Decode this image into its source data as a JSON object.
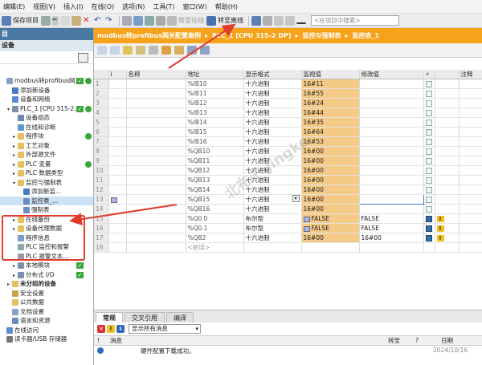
{
  "menu": [
    "编辑(E)",
    "视图(V)",
    "插入(I)",
    "在线(O)",
    "选项(N)",
    "工具(T)",
    "窗口(W)",
    "帮助(H)"
  ],
  "toolbar": {
    "save_label": "保存项目",
    "go_online": "转至在线",
    "go_offline": "转至离线",
    "search_placeholder": "<在项目中搜索>"
  },
  "left_panel": {
    "title": "目",
    "subtitle": "设备",
    "tree": [
      {
        "label": "modbus转profibus网...",
        "level": 0,
        "bold": false,
        "icon": "doc-icon",
        "status": "ok"
      },
      {
        "label": "添加新设备",
        "level": 1,
        "icon": "add-device-icon"
      },
      {
        "label": "设备和网络",
        "level": 1,
        "icon": "network-icon"
      },
      {
        "label": "PLC_1 [CPU 315-2...",
        "level": 1,
        "icon": "cpu-icon",
        "arrow": "▾",
        "status": "ok"
      },
      {
        "label": "设备组态",
        "level": 2,
        "icon": "config-icon"
      },
      {
        "label": "在线和诊断",
        "level": 2,
        "icon": "diagnose-icon"
      },
      {
        "label": "程序块",
        "level": 2,
        "icon": "folder-icon",
        "arrow": "▸",
        "status": "dot"
      },
      {
        "label": "工艺对象",
        "level": 2,
        "icon": "folder-icon",
        "arrow": "▸"
      },
      {
        "label": "外部源文件",
        "level": 2,
        "icon": "folder-icon",
        "arrow": "▸"
      },
      {
        "label": "PLC 变量",
        "level": 2,
        "icon": "folder-icon",
        "arrow": "▸",
        "status": "dot"
      },
      {
        "label": "PLC 数据类型",
        "level": 2,
        "icon": "folder-icon",
        "arrow": "▸"
      },
      {
        "label": "监控与强制表",
        "level": 2,
        "icon": "folder-icon",
        "arrow": "▾"
      },
      {
        "label": "添加新监...",
        "level": 3,
        "icon": "add-icon"
      },
      {
        "label": "监控表_...",
        "level": 3,
        "icon": "table-icon",
        "selected": true
      },
      {
        "label": "强制表",
        "level": 3,
        "icon": "table-icon"
      },
      {
        "label": "在线备份",
        "level": 2,
        "icon": "folder-icon",
        "arrow": "▸"
      },
      {
        "label": "设备代理数据",
        "level": 2,
        "icon": "folder-icon",
        "arrow": "▸"
      },
      {
        "label": "程序信息",
        "level": 2,
        "icon": "info-icon"
      },
      {
        "label": "PLC 监控和报警",
        "level": 2,
        "icon": "alarm-icon"
      },
      {
        "label": "PLC 报警文本...",
        "level": 2,
        "icon": "text-icon"
      },
      {
        "label": "本地模块",
        "level": 2,
        "icon": "module-icon",
        "arrow": "▸",
        "status": "chk"
      },
      {
        "label": "分布式 I/O",
        "level": 2,
        "icon": "io-icon",
        "arrow": "▸",
        "status": "chk"
      },
      {
        "label": "未分组的设备",
        "level": 1,
        "icon": "folder-icon",
        "arrow": "▸",
        "bold": true
      },
      {
        "label": "安全设置",
        "level": 1,
        "icon": "security-icon"
      },
      {
        "label": "公共数据",
        "level": 1,
        "icon": "folder-icon"
      },
      {
        "label": "文档设置",
        "level": 1,
        "icon": "doc-icon"
      },
      {
        "label": "语言和资源",
        "level": 1,
        "icon": "lang-icon"
      },
      {
        "label": "在线访问",
        "level": 0,
        "icon": "online-icon"
      },
      {
        "label": "读卡器/USB 存储器",
        "level": 0,
        "icon": "usb-icon"
      }
    ]
  },
  "header": {
    "crumbs": [
      "modbus转profibus网关配置案例",
      "PLC_1 [CPU 315-2 DP]",
      "监控与强制表",
      "监控表_1"
    ]
  },
  "table": {
    "columns": [
      "",
      "i",
      "名称",
      "地址",
      "显示格式",
      "监视值",
      "修改值",
      "⚡",
      "",
      "注释"
    ],
    "rows": [
      {
        "num": "1",
        "addr": "%IB10",
        "fmt": "十六进制",
        "mon": "16#11",
        "mod": "",
        "chk": false,
        "warn": false
      },
      {
        "num": "2",
        "addr": "%IB11",
        "fmt": "十六进制",
        "mon": "16#55",
        "mod": "",
        "chk": false,
        "warn": false
      },
      {
        "num": "3",
        "addr": "%IB12",
        "fmt": "十六进制",
        "mon": "16#24",
        "mod": "",
        "chk": false,
        "warn": false
      },
      {
        "num": "4",
        "addr": "%IB13",
        "fmt": "十六进制",
        "mon": "16#44",
        "mod": "",
        "chk": false,
        "warn": false
      },
      {
        "num": "5",
        "addr": "%IB14",
        "fmt": "十六进制",
        "mon": "16#35",
        "mod": "",
        "chk": false,
        "warn": false
      },
      {
        "num": "6",
        "addr": "%IB15",
        "fmt": "十六进制",
        "mon": "16#64",
        "mod": "",
        "chk": false,
        "warn": false
      },
      {
        "num": "7",
        "addr": "%IB16",
        "fmt": "十六进制",
        "mon": "16#53",
        "mod": "",
        "chk": false,
        "warn": false
      },
      {
        "num": "8",
        "addr": "%QB10",
        "fmt": "十六进制",
        "mon": "16#00",
        "mod": "",
        "chk": false,
        "warn": false
      },
      {
        "num": "9",
        "addr": "%QB11",
        "fmt": "十六进制",
        "mon": "16#00",
        "mod": "",
        "chk": false,
        "warn": false
      },
      {
        "num": "10",
        "addr": "%QB12",
        "fmt": "十六进制",
        "mon": "16#00",
        "mod": "",
        "chk": false,
        "warn": false
      },
      {
        "num": "11",
        "addr": "%QB13",
        "fmt": "十六进制",
        "mon": "16#00",
        "mod": "",
        "chk": false,
        "warn": false
      },
      {
        "num": "12",
        "addr": "%QB14",
        "fmt": "十六进制",
        "mon": "16#00",
        "mod": "",
        "chk": false,
        "warn": false
      },
      {
        "num": "13",
        "addr": "%QB15",
        "fmt": "十六进制",
        "mon": "16#00",
        "mod": "",
        "chk": false,
        "warn": false,
        "active": true
      },
      {
        "num": "14",
        "addr": "%QB16",
        "fmt": "十六进制",
        "mon": "16#00",
        "mod": "",
        "chk": false,
        "warn": false
      },
      {
        "num": "15",
        "addr": "%Q0.0",
        "fmt": "布尔型",
        "mon": "FALSE",
        "mod": "FALSE",
        "chk": true,
        "warn": true,
        "boolicon": true
      },
      {
        "num": "16",
        "addr": "%Q0.1",
        "fmt": "布尔型",
        "mon": "FALSE",
        "mod": "FALSE",
        "chk": true,
        "warn": true,
        "boolicon": true
      },
      {
        "num": "17",
        "addr": "%QB2",
        "fmt": "十六进制",
        "mon": "16#00",
        "mod": "16#00",
        "chk": true,
        "warn": true
      },
      {
        "num": "18",
        "addr": "<新增>",
        "fmt": "",
        "mon": "",
        "mod": "",
        "chk": false,
        "warn": false,
        "newrow": true
      }
    ]
  },
  "bottom": {
    "tabs": [
      "常规",
      "交叉引用",
      "编译"
    ],
    "filter": "显示所有消息",
    "columns": [
      "!",
      "消息",
      "转至",
      "?",
      "日期"
    ],
    "message": "硬件配置下载成功。",
    "date": "2024/10/16"
  },
  "watermark": "北布千 Jingke"
}
